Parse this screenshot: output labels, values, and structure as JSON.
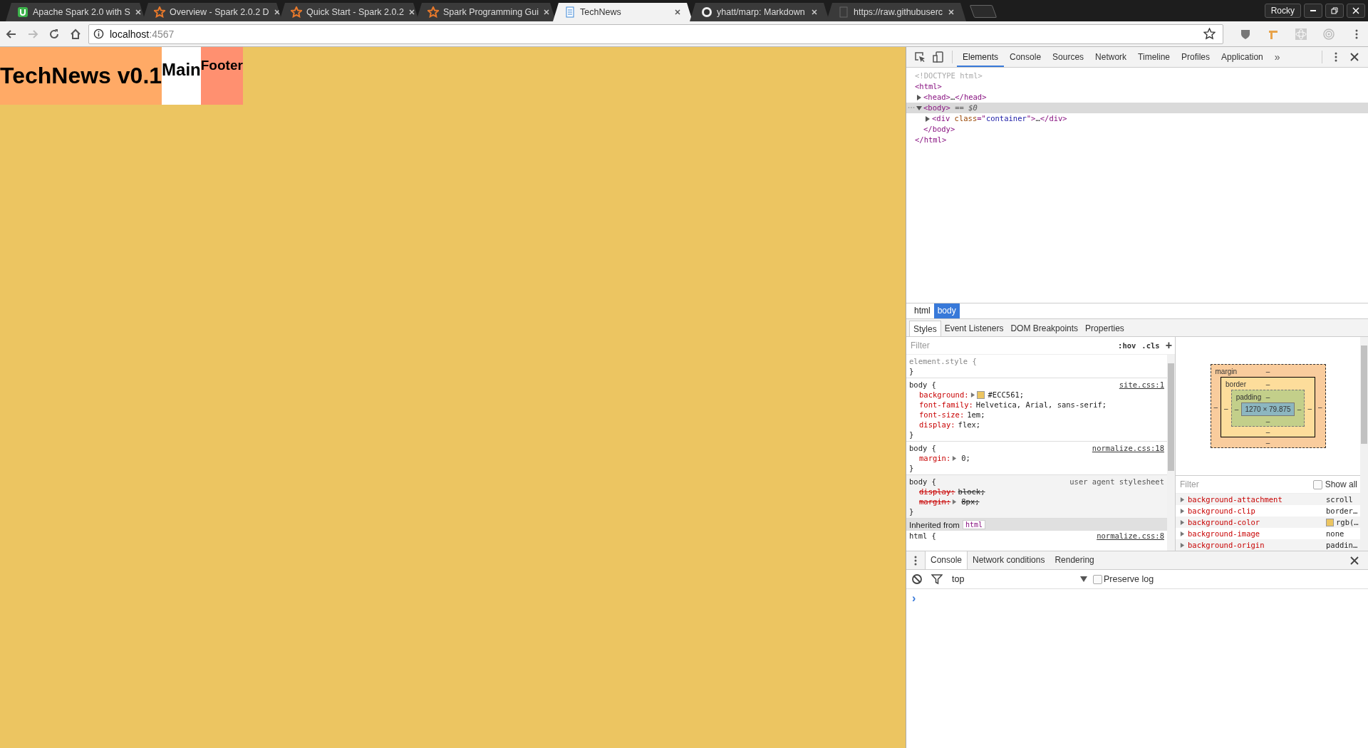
{
  "browser": {
    "tabs": [
      {
        "title": "Apache Spark 2.0 with S",
        "kind": "badge",
        "selected": false
      },
      {
        "title": "Overview - Spark 2.0.2 D",
        "kind": "star",
        "selected": false
      },
      {
        "title": "Quick Start - Spark 2.0.2",
        "kind": "star",
        "selected": false
      },
      {
        "title": "Spark Programming Gui",
        "kind": "star",
        "selected": false
      },
      {
        "title": "TechNews",
        "kind": "document",
        "selected": true
      },
      {
        "title": "yhatt/marp: Markdown",
        "kind": "ring",
        "selected": false
      },
      {
        "title": "https://raw.githubuserc",
        "kind": "page",
        "selected": false
      }
    ],
    "profile": "Rocky",
    "address": {
      "host": "localhost",
      "port": ":4567"
    }
  },
  "page": {
    "title": "TechNews v0.1",
    "main": "Main",
    "footer": "Footer"
  },
  "devtools": {
    "tabs": [
      {
        "label": "Elements",
        "selected": true
      },
      {
        "label": "Console",
        "selected": false
      },
      {
        "label": "Sources",
        "selected": false
      },
      {
        "label": "Network",
        "selected": false
      },
      {
        "label": "Timeline",
        "selected": false
      },
      {
        "label": "Profiles",
        "selected": false
      },
      {
        "label": "Application",
        "selected": false
      }
    ],
    "overflow": "»",
    "dom": [
      {
        "parts": [
          {
            "kind": "doctype",
            "text": "<!DOCTYPE html>"
          }
        ],
        "selected": false
      },
      {
        "parts": [
          {
            "kind": "tag",
            "text": "<html>"
          }
        ],
        "selected": false,
        "close": [
          {
            "kind": "tag",
            "text": "</html>"
          }
        ],
        "children": [
          {
            "parts": [
              {
                "kind": "tag",
                "text": "<head>"
              },
              {
                "kind": "plain",
                "text": "…"
              },
              {
                "kind": "tag",
                "text": "</head>"
              }
            ],
            "expanded": false,
            "selected": false
          },
          {
            "parts": [
              {
                "kind": "tag",
                "text": "<body>"
              },
              {
                "kind": "marker",
                "text": " == $0"
              }
            ],
            "expanded": true,
            "selected": true,
            "close": [
              {
                "kind": "tag",
                "text": "</body>"
              }
            ],
            "children": [
              {
                "parts": [
                  {
                    "kind": "tag",
                    "text": "<div "
                  },
                  {
                    "kind": "attr",
                    "text": "class"
                  },
                  {
                    "kind": "tag",
                    "text": "=\""
                  },
                  {
                    "kind": "value",
                    "text": "container"
                  },
                  {
                    "kind": "tag",
                    "text": "\">"
                  },
                  {
                    "kind": "plain",
                    "text": "…"
                  },
                  {
                    "kind": "tag",
                    "text": "</div>"
                  }
                ],
                "expanded": false,
                "selected": false
              }
            ]
          }
        ]
      }
    ],
    "breadcrumbs": [
      {
        "label": "html",
        "selected": false
      },
      {
        "label": "body",
        "selected": true
      }
    ],
    "panel_tabs": [
      {
        "label": "Styles",
        "selected": true
      },
      {
        "label": "Event Listeners",
        "selected": false
      },
      {
        "label": "DOM Breakpoints",
        "selected": false
      },
      {
        "label": "Properties",
        "selected": false
      }
    ],
    "styles": {
      "filter_placeholder": "Filter",
      "hov": ":hov",
      "cls": ".cls",
      "add": "+",
      "rules": [
        {
          "kind": "inline",
          "header": "element.style {",
          "close": "}"
        },
        {
          "kind": "author",
          "header": "body {",
          "source": "site.css:1",
          "close": "}",
          "props": [
            {
              "name": "background:",
              "value": "#ECC561;",
              "expandable": true,
              "color": "#ecc561",
              "overridden": false
            },
            {
              "name": "font-family:",
              "value": "Helvetica, Arial, sans-serif;",
              "expandable": false,
              "overridden": false
            },
            {
              "name": "font-size:",
              "value": "1em;",
              "expandable": false,
              "overridden": false
            },
            {
              "name": "display:",
              "value": "flex;",
              "expandable": false,
              "overridden": false
            }
          ]
        },
        {
          "kind": "author",
          "header": "body {",
          "source": "normalize.css:18",
          "close": "}",
          "props": [
            {
              "name": "margin:",
              "value": "0;",
              "expandable": true,
              "overridden": false
            }
          ]
        },
        {
          "kind": "user-agent",
          "header": "body {",
          "source": "user agent stylesheet",
          "close": "}",
          "props": [
            {
              "name": "display:",
              "value": "block;",
              "expandable": false,
              "overridden": true
            },
            {
              "name": "margin:",
              "value": "8px;",
              "expandable": true,
              "overridden": true
            }
          ]
        }
      ],
      "inherited": {
        "label": "Inherited from",
        "from": "html"
      },
      "last_rule": {
        "header": "html {",
        "source": "normalize.css:8"
      }
    },
    "box_model": {
      "margin": {
        "label": "margin",
        "top": "–",
        "right": "–",
        "bottom": "–",
        "left": "–"
      },
      "border": {
        "label": "border",
        "top": "–",
        "right": "–",
        "bottom": "–",
        "left": "–"
      },
      "padding": {
        "label": "padding",
        "top": "–",
        "right": "–",
        "bottom": "–",
        "left": "–"
      },
      "content": "1270 × 79.875"
    },
    "computed": {
      "filter_placeholder": "Filter",
      "show_all": {
        "label": "Show all",
        "checked": false
      },
      "props": [
        {
          "name": "background-attachment",
          "value": "scroll"
        },
        {
          "name": "background-clip",
          "value": "border…"
        },
        {
          "name": "background-color",
          "value": "rgb(…",
          "color": "#ecc561"
        },
        {
          "name": "background-image",
          "value": "none"
        },
        {
          "name": "background-origin",
          "value": "paddin…"
        }
      ]
    },
    "drawer": {
      "tabs": [
        {
          "label": "Console",
          "selected": true
        },
        {
          "label": "Network conditions",
          "selected": false
        },
        {
          "label": "Rendering",
          "selected": false
        }
      ],
      "context": "top",
      "preserve_log": {
        "label": "Preserve log",
        "checked": false
      },
      "prompt": "›"
    }
  }
}
